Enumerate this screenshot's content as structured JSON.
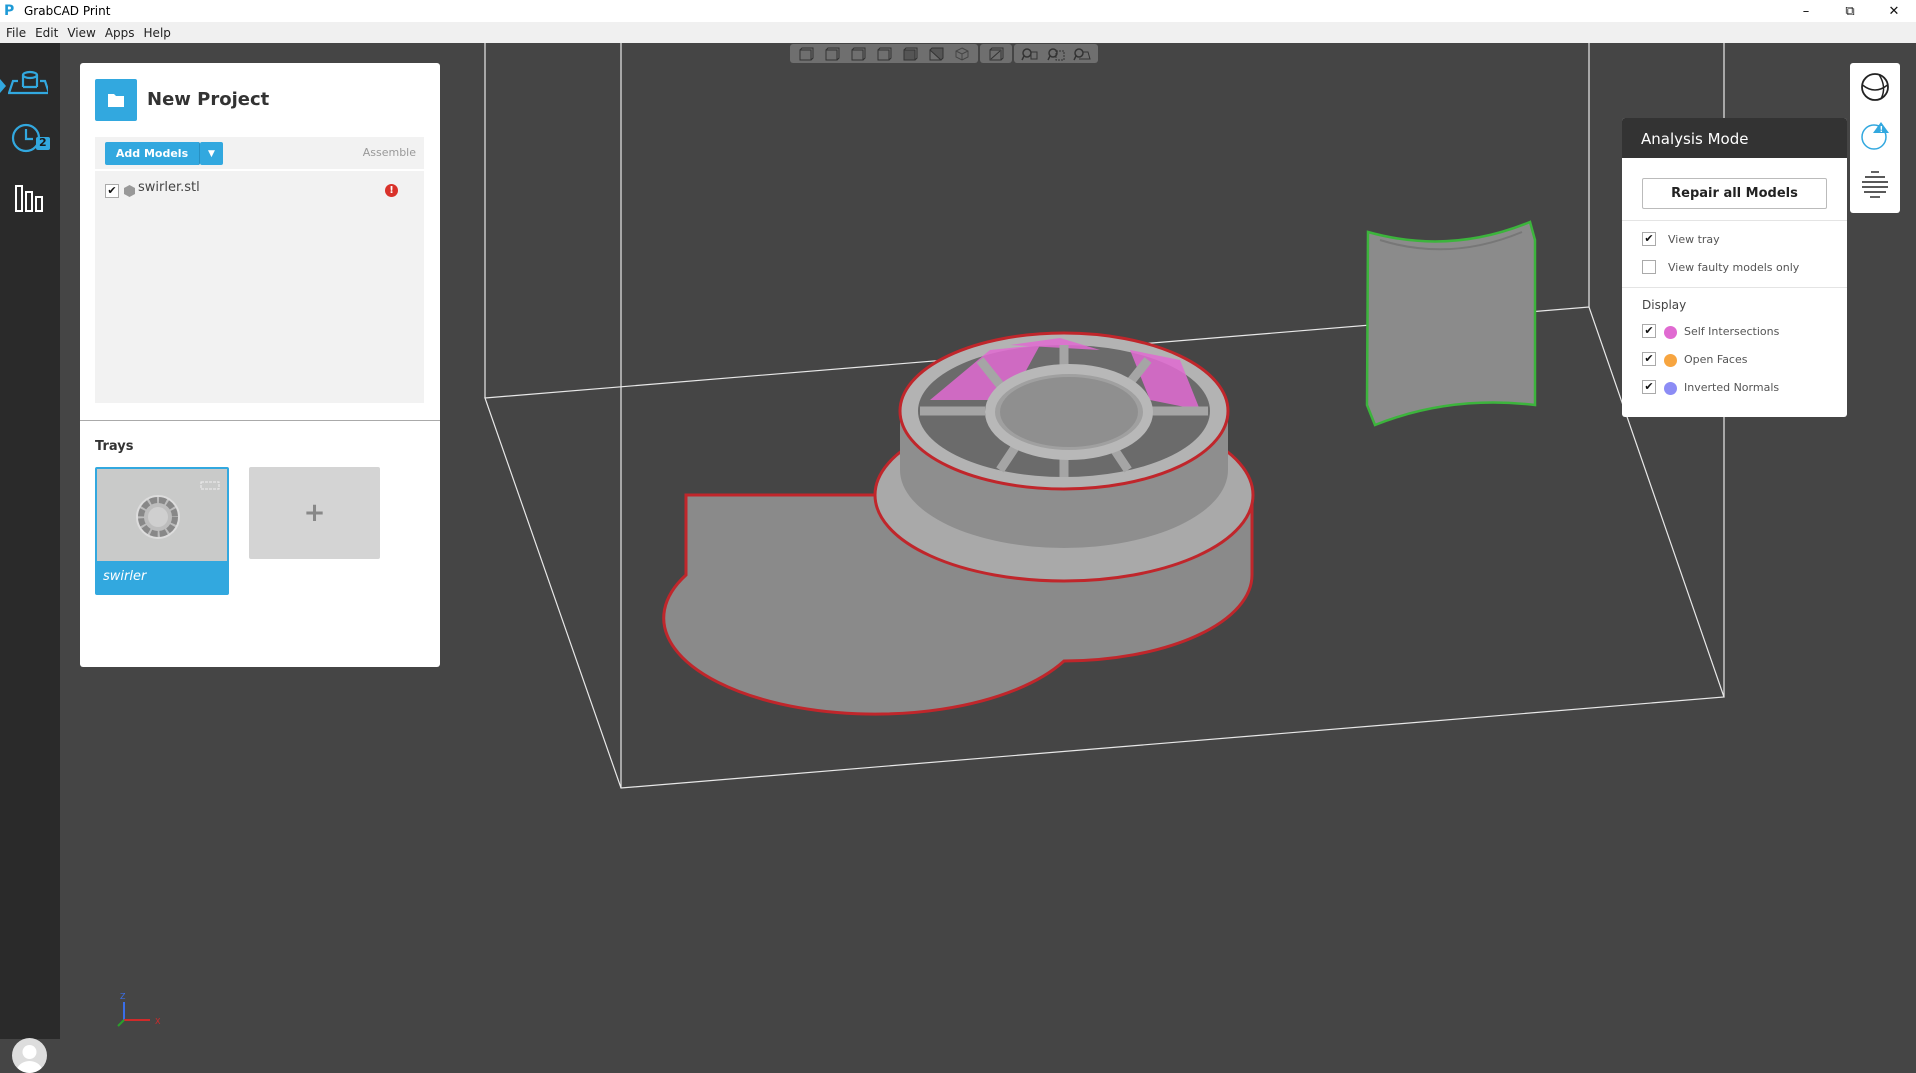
{
  "window": {
    "title": "GrabCAD Print",
    "controls": [
      "minimize",
      "restore",
      "close"
    ]
  },
  "menu": [
    "File",
    "Edit",
    "View",
    "Apps",
    "Help"
  ],
  "sidebar": {
    "items": [
      {
        "icon": "prepare-tray-icon",
        "active": true
      },
      {
        "icon": "print-queue-clock-icon",
        "badge": "2"
      },
      {
        "icon": "dashboard-bars-icon"
      }
    ]
  },
  "project": {
    "title": "New Project",
    "add_models_label": "Add Models",
    "assemble_label": "Assemble",
    "models": [
      {
        "name": "swirler.stl",
        "checked": true,
        "error": "!"
      }
    ],
    "trays_label": "Trays",
    "trays": [
      {
        "name": "swirler",
        "selected": true
      }
    ],
    "add_tray_label": "+"
  },
  "view_toolbar": {
    "groups": [
      [
        "view-front-icon",
        "view-back-icon",
        "view-left-icon",
        "view-right-icon",
        "view-top-icon",
        "view-bottom-icon",
        "view-iso-icon"
      ],
      [
        "section-view-icon"
      ],
      [
        "zoom-fit-icon",
        "zoom-selection-icon",
        "zoom-tray-icon"
      ]
    ]
  },
  "mode_panel": {
    "icons": [
      "model-view-icon",
      "analysis-mode-icon",
      "slice-preview-icon"
    ],
    "active": 1
  },
  "analysis": {
    "title": "Analysis Mode",
    "repair_label": "Repair all Models",
    "view_tray": {
      "label": "View tray",
      "checked": true
    },
    "faulty_only": {
      "label": "View faulty models only",
      "checked": false
    },
    "display_label": "Display",
    "display": [
      {
        "label": "Self Intersections",
        "checked": true,
        "color": "#e06ad1"
      },
      {
        "label": "Open Faces",
        "checked": true,
        "color": "#f7a540"
      },
      {
        "label": "Inverted Normals",
        "checked": true,
        "color": "#8c8cf5"
      }
    ]
  },
  "axes": {
    "x": "X",
    "z": "Z"
  },
  "colors": {
    "accent": "#32a8df",
    "error_outline": "#c0262b",
    "selected_outline": "#3cb43c"
  }
}
